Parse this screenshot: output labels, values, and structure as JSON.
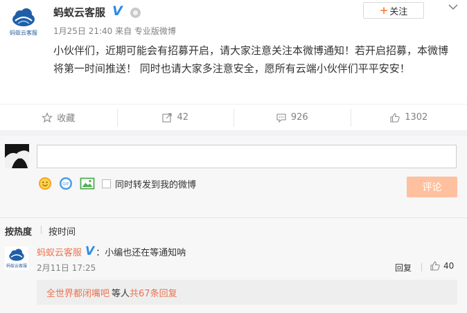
{
  "post": {
    "author": "蚂蚁云客服",
    "avatar_brand": "蚂蚁云客服",
    "verified_mark": "V",
    "follow_label": "关注",
    "follow_plus": "+",
    "meta": "1月25日 21:40 来自 专业版微博",
    "content": "小伙伴们，近期可能会有招募开启，请大家注意关注本微博通知！若开启招募，本微博将第一时间推送！ 同时也请大家多注意安全，愿所有云端小伙伴们平平安安！"
  },
  "actions": {
    "favorite_label": "收藏",
    "repost_count": "42",
    "comment_count": "926",
    "like_count": "1302"
  },
  "composer": {
    "input_value": "",
    "repost_label": "同时转发到我的微博",
    "submit_label": "评论"
  },
  "sort": {
    "hot_label": "按热度",
    "time_label": "按时间"
  },
  "comments": [
    {
      "author": "蚂蚁云客服",
      "avatar_brand": "蚂蚁云客服",
      "verified_mark": "V",
      "text": "：小编也还在等通知呐",
      "time": "2月11日 17:25",
      "reply_label": "回复",
      "like_count": "40",
      "reply_preview": {
        "author": "全世界都闭嘴吧",
        "middle": "等人",
        "count_text": "共67条回复"
      }
    }
  ],
  "colors": {
    "brand_blue": "#2e8ae6",
    "accent_orange": "#ff8140",
    "link_orange": "#eb7350",
    "submit_disabled": "#ffc09f",
    "emoji_yellow": "#f5a623"
  }
}
